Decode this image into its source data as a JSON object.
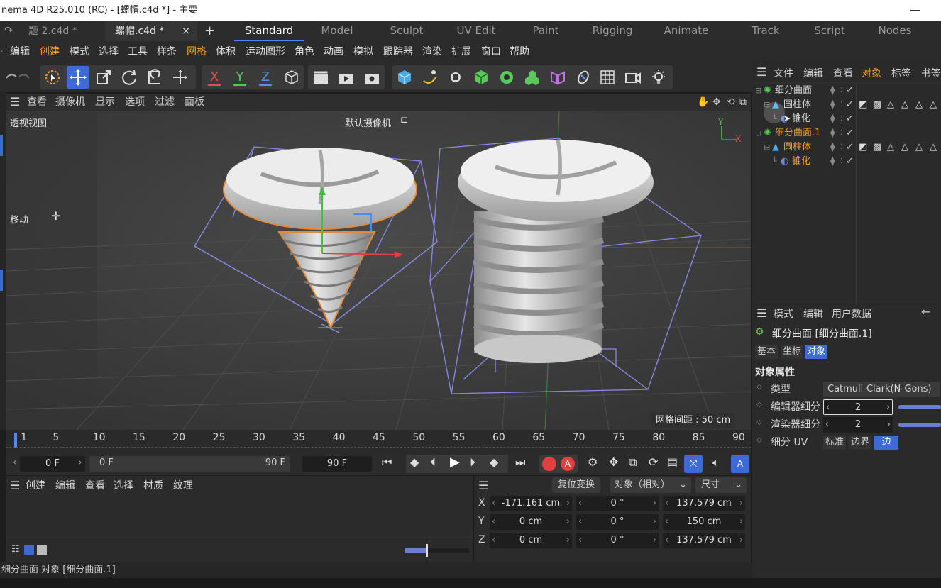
{
  "window": {
    "title": "nema 4D R25.010 (RC) - [螺帽.c4d *] - 主要"
  },
  "doc_tabs": [
    {
      "label": "题 2.c4d *",
      "active": false
    },
    {
      "label": "螺帽.c4d *",
      "active": true
    }
  ],
  "doc_tab_close": "×",
  "doc_tab_add": "+",
  "layout_tabs": [
    "Standard",
    "Model",
    "Sculpt",
    "UV Edit",
    "Paint",
    "Rigging",
    "Animate",
    "Track",
    "Script",
    "Nodes"
  ],
  "active_layout": "Standard",
  "menu": [
    "编辑",
    "创建",
    "模式",
    "选择",
    "工具",
    "样条",
    "网格",
    "体积",
    "运动图形",
    "角色",
    "动画",
    "模拟",
    "跟踪器",
    "渲染",
    "扩展",
    "窗口",
    "帮助"
  ],
  "axis_buttons": [
    "X",
    "Y",
    "Z"
  ],
  "viewport_menu": [
    "查看",
    "摄像机",
    "显示",
    "选项",
    "过滤",
    "面板"
  ],
  "viewport": {
    "view_name": "透视视图",
    "camera": "默认摄像机",
    "tool_label": "移动",
    "grid_spacing": "网格间距 : 50 cm",
    "axis_x": "X",
    "axis_y": "Y"
  },
  "timeline": {
    "ticks": [
      "1",
      "5",
      "10",
      "15",
      "20",
      "25",
      "30",
      "35",
      "40",
      "45",
      "50",
      "55",
      "60",
      "65",
      "70",
      "75",
      "80",
      "85",
      "90"
    ],
    "current_frame": "0 F",
    "range_start": "0 F",
    "range_end": "90 F",
    "end_frame": "90 F"
  },
  "material_menu": [
    "创建",
    "编辑",
    "查看",
    "选择",
    "材质",
    "纹理"
  ],
  "coords": {
    "reset_label": "复位变换",
    "mode_label": "对象（相对）",
    "size_label": "尺寸",
    "rows": [
      {
        "axis": "X",
        "pos": "-171.161 cm",
        "rot": "0 °",
        "size": "137.579 cm"
      },
      {
        "axis": "Y",
        "pos": "0 cm",
        "rot": "0 °",
        "size": "150 cm"
      },
      {
        "axis": "Z",
        "pos": "0 cm",
        "rot": "0 °",
        "size": "137.579 cm"
      }
    ]
  },
  "status": "细分曲面 对象 [细分曲面.1]",
  "object_manager": {
    "menu": [
      "文件",
      "编辑",
      "查看",
      "对象",
      "标签",
      "书签"
    ],
    "objects": [
      {
        "name": "细分曲面",
        "level": 0,
        "color": "#d6d6d6"
      },
      {
        "name": "圆柱体",
        "level": 1,
        "color": "#d6d6d6"
      },
      {
        "name": "锥化",
        "level": 2,
        "color": "#d6d6d6"
      },
      {
        "name": "细分曲面.1",
        "level": 0,
        "color": "#f0a020"
      },
      {
        "name": "圆柱体",
        "level": 1,
        "color": "#f0a020"
      },
      {
        "name": "锥化",
        "level": 2,
        "color": "#f0a020"
      }
    ]
  },
  "attributes": {
    "menu": [
      "模式",
      "编辑",
      "用户数据"
    ],
    "object_title": "细分曲面 [细分曲面.1]",
    "tabs": [
      "基本",
      "坐标",
      "对象"
    ],
    "active_tab": "对象",
    "section": "对象属性",
    "fields": [
      {
        "label": "类型",
        "value": "Catmull-Clark(N-Gons)"
      },
      {
        "label": "编辑器细分",
        "value": "2"
      },
      {
        "label": "渲染器细分",
        "value": "2"
      },
      {
        "label": "细分 UV",
        "options": [
          "标准",
          "边界",
          "边"
        ],
        "selected": "边"
      }
    ]
  },
  "colors": {
    "accent": "#4b8bff",
    "selection": "#f0a020",
    "bbox": "#8a8ae6",
    "highlight": "#3c6bd6"
  }
}
